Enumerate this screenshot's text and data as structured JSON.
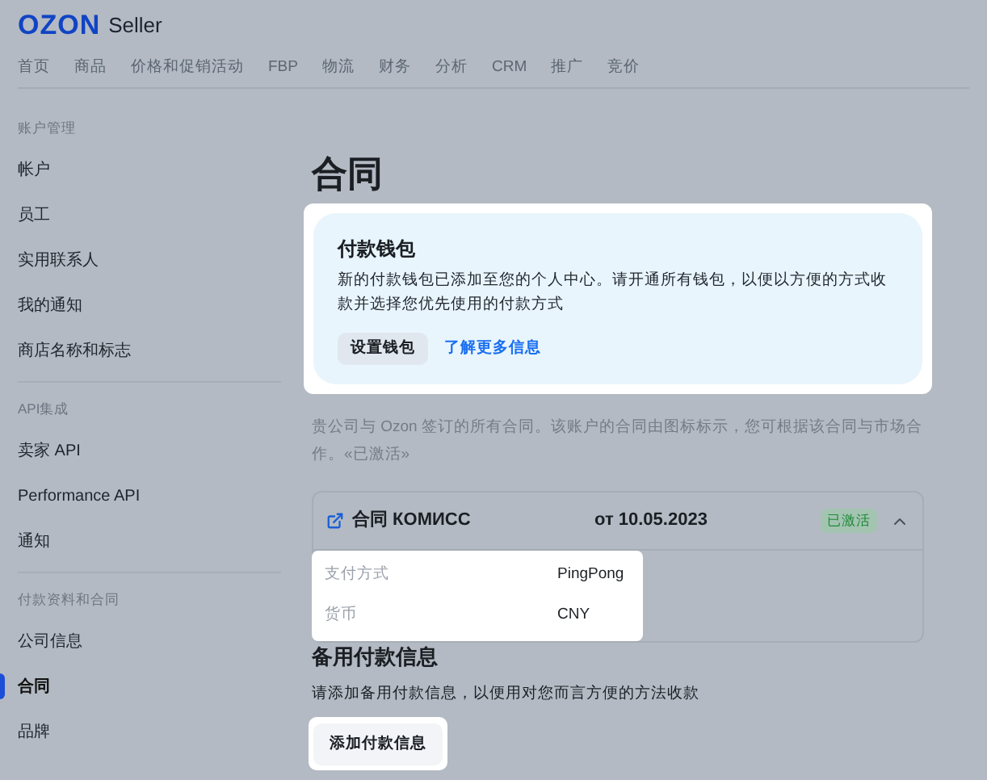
{
  "header": {
    "brand": "OZON",
    "product": "Seller"
  },
  "nav": [
    "首页",
    "商品",
    "价格和促销活动",
    "FBP",
    "物流",
    "财务",
    "分析",
    "CRM",
    "推广",
    "竞价"
  ],
  "sidebar": {
    "sections": [
      {
        "title": "账户管理",
        "items": [
          {
            "label": "帐户",
            "selected": false
          },
          {
            "label": "员工",
            "selected": false
          },
          {
            "label": "实用联系人",
            "selected": false
          },
          {
            "label": "我的通知",
            "selected": false
          },
          {
            "label": "商店名称和标志",
            "selected": false
          }
        ]
      },
      {
        "title": "API集成",
        "items": [
          {
            "label": "卖家 API",
            "selected": false
          },
          {
            "label": "Performance API",
            "selected": false
          },
          {
            "label": "通知",
            "selected": false
          }
        ]
      },
      {
        "title": "付款资料和合同",
        "items": [
          {
            "label": "公司信息",
            "selected": false
          },
          {
            "label": "合同",
            "selected": true
          },
          {
            "label": "品牌",
            "selected": false
          }
        ]
      }
    ]
  },
  "page_title": "合同",
  "wallet_notice": {
    "highlighted": true,
    "title": "付款钱包",
    "text": "新的付款钱包已添加至您的个人中心。请开通所有钱包，以便以方便的方式收款并选择您优先使用的付款方式",
    "button": "设置钱包",
    "link": "了解更多信息"
  },
  "description": "贵公司与 Ozon 签订的所有合同。该账户的合同由图标标示，您可根据该合同与市场合作。«已激活»",
  "contract": {
    "title": "合同 КОМИСС",
    "date": "от 10.05.2023",
    "status": "已激活",
    "expanded": true,
    "details_highlighted": true,
    "details": [
      {
        "label": "支付方式",
        "value": "PingPong"
      },
      {
        "label": "货币",
        "value": "CNY"
      }
    ]
  },
  "backup": {
    "title": "备用付款信息",
    "text": "请添加备用付款信息，以便用对您而言方便的方法收款",
    "button": "添加付款信息",
    "highlighted": true
  }
}
